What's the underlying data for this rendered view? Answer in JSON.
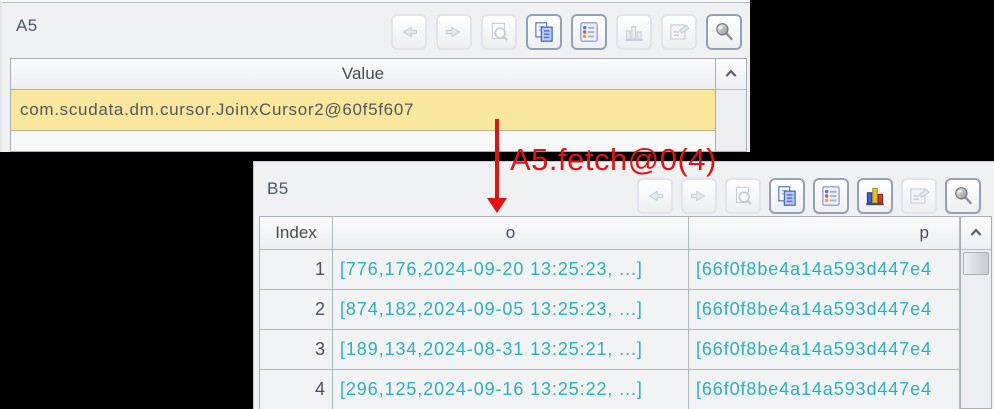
{
  "colors": {
    "background": "#000000",
    "panel_bg": "#f0f1f3",
    "highlight_row_yellow": "#f8e79c",
    "cell_text_teal": "#2ab2ba",
    "annotation_red": "#e81111"
  },
  "panel_a5": {
    "title": "A5",
    "toolbar": {
      "buttons": [
        {
          "name": "back",
          "enabled": false
        },
        {
          "name": "forward",
          "enabled": false
        },
        {
          "name": "print-preview",
          "enabled": false
        },
        {
          "name": "copy",
          "enabled": true
        },
        {
          "name": "properties",
          "enabled": true
        },
        {
          "name": "chart",
          "enabled": false
        },
        {
          "name": "draw-form",
          "enabled": false
        },
        {
          "name": "pin",
          "enabled": true
        }
      ]
    },
    "table": {
      "columns": [
        "Value"
      ],
      "rows": [
        {
          "value": "com.scudata.dm.cursor.JoinxCursor2@60f5f607",
          "highlighted": true
        }
      ]
    }
  },
  "annotation": {
    "label": "A5.fetch@0(4)"
  },
  "panel_b5": {
    "title": "B5",
    "toolbar": {
      "buttons": [
        {
          "name": "back",
          "enabled": false
        },
        {
          "name": "forward",
          "enabled": false
        },
        {
          "name": "print-preview",
          "enabled": false
        },
        {
          "name": "copy",
          "enabled": true
        },
        {
          "name": "properties",
          "enabled": true
        },
        {
          "name": "chart",
          "enabled": true
        },
        {
          "name": "draw-form",
          "enabled": false
        },
        {
          "name": "pin",
          "enabled": true
        }
      ]
    },
    "table": {
      "columns": [
        "Index",
        "o",
        "p"
      ],
      "rows": [
        {
          "index": "1",
          "o": "[776,176,2024-09-20 13:25:23, ...]",
          "p": "[66f0f8be4a14a593d447e4"
        },
        {
          "index": "2",
          "o": "[874,182,2024-09-05 13:25:23, ...]",
          "p": "[66f0f8be4a14a593d447e4"
        },
        {
          "index": "3",
          "o": "[189,134,2024-08-31 13:25:21, ...]",
          "p": "[66f0f8be4a14a593d447e4"
        },
        {
          "index": "4",
          "o": "[296,125,2024-09-16 13:25:22, ...]",
          "p": "[66f0f8be4a14a593d447e4"
        }
      ]
    }
  }
}
